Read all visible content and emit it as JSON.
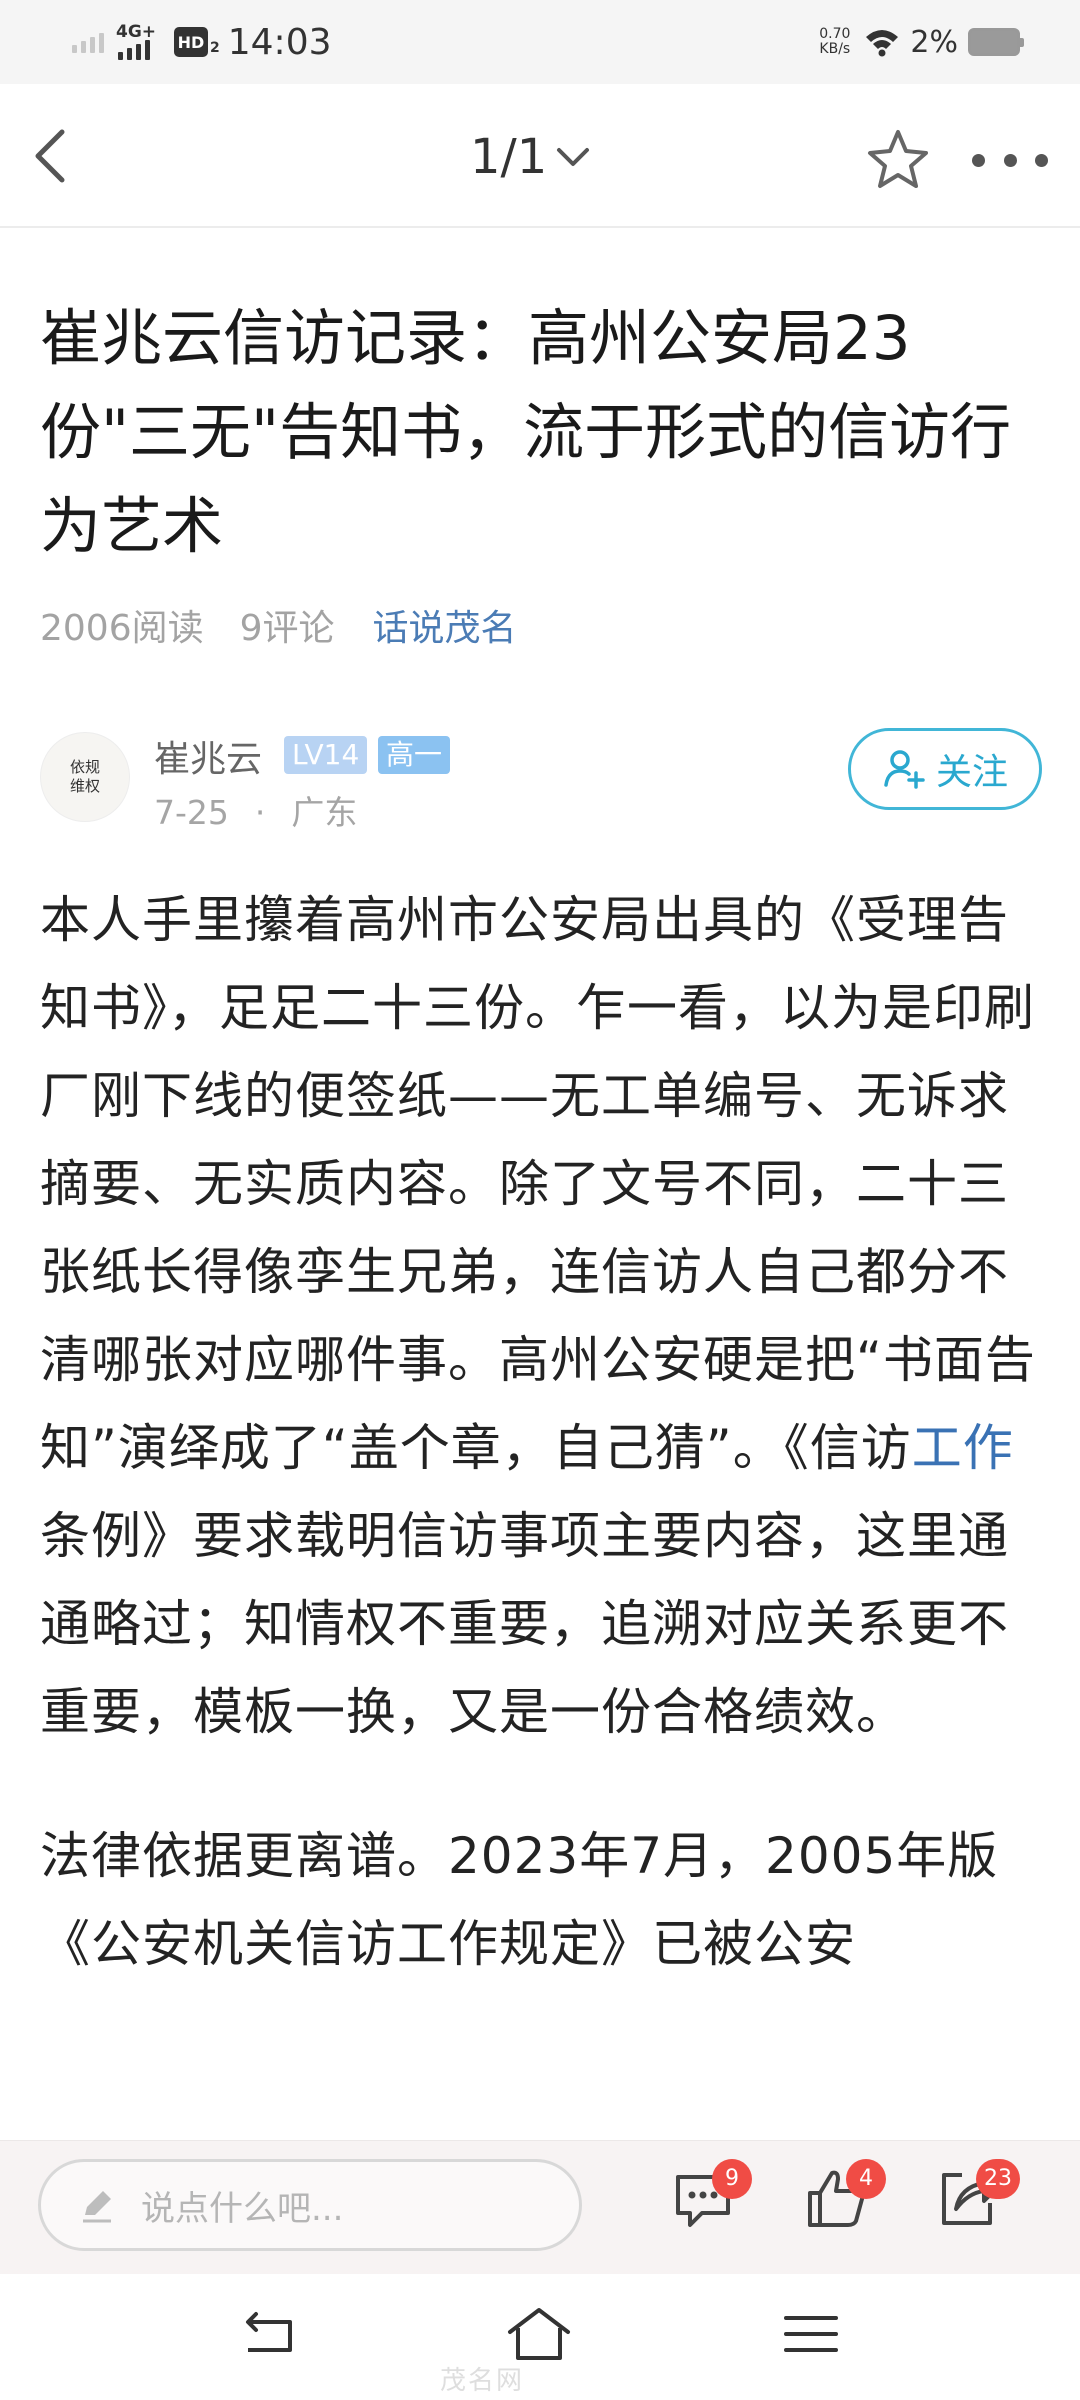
{
  "status_bar": {
    "network": "4G+",
    "hd": "HD",
    "hd_sub": "2",
    "time": "14:03",
    "speed_value": "0.70",
    "speed_unit": "KB/s",
    "battery": "2%"
  },
  "header": {
    "back_icon": "chevron-left-icon",
    "page_indicator": "1/1",
    "dropdown_icon": "chevron-down-icon",
    "favorite_icon": "star-icon",
    "more_icon": "more-dots-icon"
  },
  "article": {
    "title": "崔兆云信访记录：高州公安局23份\"三无\"告知书，流于形式的信访行为艺术",
    "views": "2006阅读",
    "comments": "9评论",
    "topic": "话说茂名",
    "author": {
      "avatar_text": "依规维权",
      "name": "崔兆云",
      "level": "LV14",
      "grade": "高一",
      "date": "7-25",
      "separator": "·",
      "location": "广东",
      "follow_label": "关注"
    },
    "paragraph1_part1": "本人手里攥着高州市公安局出具的《受理告知书》，足足二十三份。乍一看，以为是印刷厂刚下线的便签纸——无工单编号、无诉求摘要、无实质内容。除了文号不同，二十三张纸长得像孪生兄弟，连信访人自己都分不清哪张对应哪件事。高州公安硬是把“书面告知”演绎成了“盖个章，自己猜”。《信访",
    "paragraph1_link": "工作",
    "paragraph1_part2": "条例》要求载明信访事项主要内容，这里通通略过；知情权不重要，追溯对应关系更不重要，模板一换，又是一份合格绩效。",
    "paragraph2": "法律依据更离谱。2023年7月，2005年版《公安机关信访工作规定》已被公安"
  },
  "comment_bar": {
    "placeholder": "说点什么吧...",
    "comment_count": "9",
    "like_count": "4",
    "share_count": "23"
  },
  "nav_bar": {
    "watermark": "茂名网"
  },
  "colors": {
    "accent": "#41b6d7",
    "link": "#3a72b4",
    "badge_red": "#f04c45"
  }
}
